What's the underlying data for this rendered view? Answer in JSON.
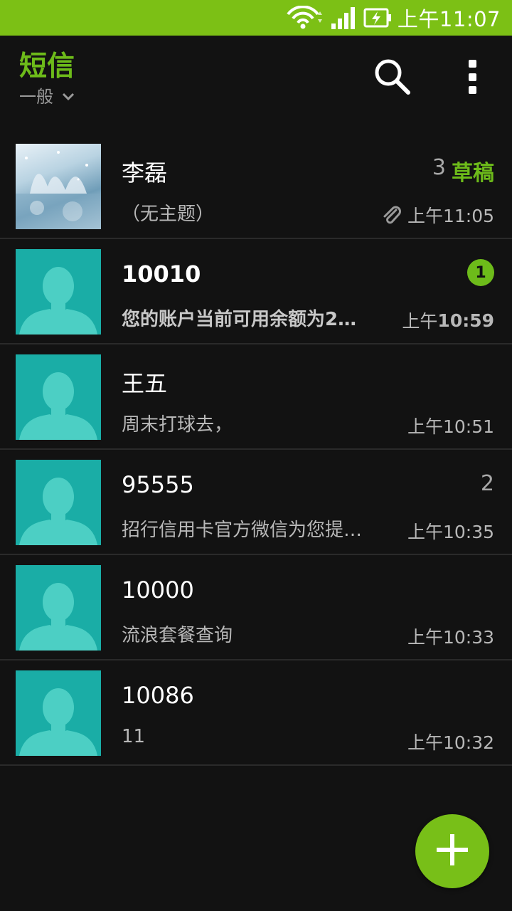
{
  "status_bar": {
    "time": "上午11:07"
  },
  "app_bar": {
    "title": "短信",
    "folder": "一般"
  },
  "threads": [
    {
      "name": "李磊",
      "snippet": "（无主题）",
      "time": "上午11:05",
      "draft_count": "3",
      "draft_label": "草稿",
      "avatar": "snow-landscape-photo"
    },
    {
      "name": "10010",
      "snippet": "您的账户当前可用余额为2…",
      "time_prefix": "上午",
      "time_value": "10:59",
      "unread_badge": "1",
      "avatar": "default-contact"
    },
    {
      "name": "王五",
      "snippet": "周末打球去，",
      "time": "上午10:51",
      "avatar": "default-contact"
    },
    {
      "name": "95555",
      "snippet": "招行信用卡官方微信为您提…",
      "time": "上午10:35",
      "message_count": "2",
      "avatar": "default-contact"
    },
    {
      "name": "10000",
      "snippet": "流浪套餐查询",
      "time": "上午10:33",
      "avatar": "default-contact"
    },
    {
      "name": "10086",
      "snippet": "11",
      "time": "上午10:32",
      "avatar": "default-contact"
    }
  ],
  "colors": {
    "accent": "#6dbb1a",
    "status_bar": "#7cc015",
    "background": "#121212",
    "avatar_default": "#1aada6"
  }
}
